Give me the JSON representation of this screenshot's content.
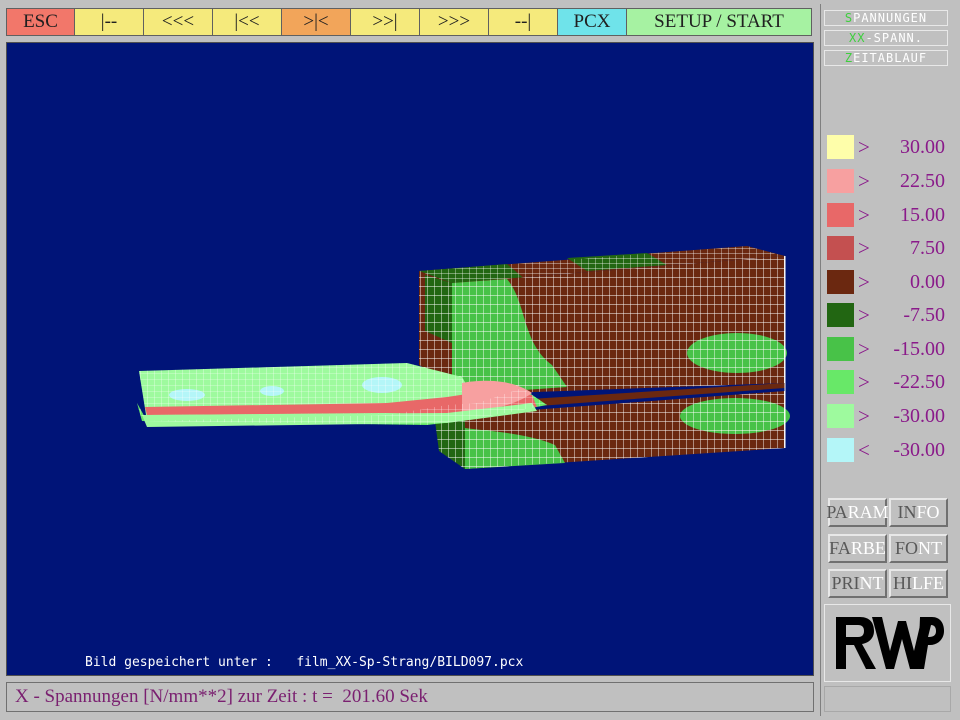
{
  "toolbar": {
    "buttons": [
      {
        "label": "ESC",
        "color": "#f2776a"
      },
      {
        "label": "|--",
        "color": "#f5ea7c"
      },
      {
        "label": "<<<",
        "color": "#f5ea7c"
      },
      {
        "label": "|<<",
        "color": "#f5ea7c"
      },
      {
        "label": ">|<",
        "color": "#f2a55a"
      },
      {
        "label": ">>|",
        "color": "#f5ea7c"
      },
      {
        "label": ">>>",
        "color": "#f5ea7c"
      },
      {
        "label": "--|",
        "color": "#f5ea7c"
      },
      {
        "label": "PCX",
        "color": "#6fe3ea"
      },
      {
        "label": "SETUP / START",
        "color": "#a6f2a2"
      }
    ]
  },
  "modes": [
    {
      "hot": "S",
      "rest": "PANNUNGEN"
    },
    {
      "hot": "XX",
      "rest": "-SPANN."
    },
    {
      "hot": "Z",
      "rest": "EITABLAUF"
    }
  ],
  "legend": [
    {
      "symbol": ">",
      "value": "30.00",
      "color": "#fefeaa"
    },
    {
      "symbol": ">",
      "value": "22.50",
      "color": "#f7a0a0"
    },
    {
      "symbol": ">",
      "value": "15.00",
      "color": "#e86868"
    },
    {
      "symbol": ">",
      "value": "7.50",
      "color": "#c45050"
    },
    {
      "symbol": ">",
      "value": "0.00",
      "color": "#6b2810"
    },
    {
      "symbol": ">",
      "value": "-7.50",
      "color": "#226612"
    },
    {
      "symbol": ">",
      "value": "-15.00",
      "color": "#48c248"
    },
    {
      "symbol": ">",
      "value": "-22.50",
      "color": "#68e868"
    },
    {
      "symbol": ">",
      "value": "-30.00",
      "color": "#9efa9e"
    },
    {
      "symbol": "<",
      "value": "-30.00",
      "color": "#b4f6f8"
    }
  ],
  "controls": [
    {
      "hot": "PA",
      "rest": "RAM"
    },
    {
      "hot": "IN",
      "rest": "FO"
    },
    {
      "hot": "FA",
      "rest": "RBE"
    },
    {
      "hot": "FO",
      "rest": "NT"
    },
    {
      "hot": "PRI",
      "rest": "NT"
    },
    {
      "hot": "HI",
      "rest": "LFE"
    }
  ],
  "logo": "RWP",
  "viewport": {
    "saved_label": "Bild gespeichert unter :",
    "saved_path": "film_XX-Sp-Strang/BILD097.pcx",
    "background": "#001478"
  },
  "status": {
    "text": "X - Spannungen [N/mm**2] zur Zeit : t =  201.60 Sek"
  }
}
